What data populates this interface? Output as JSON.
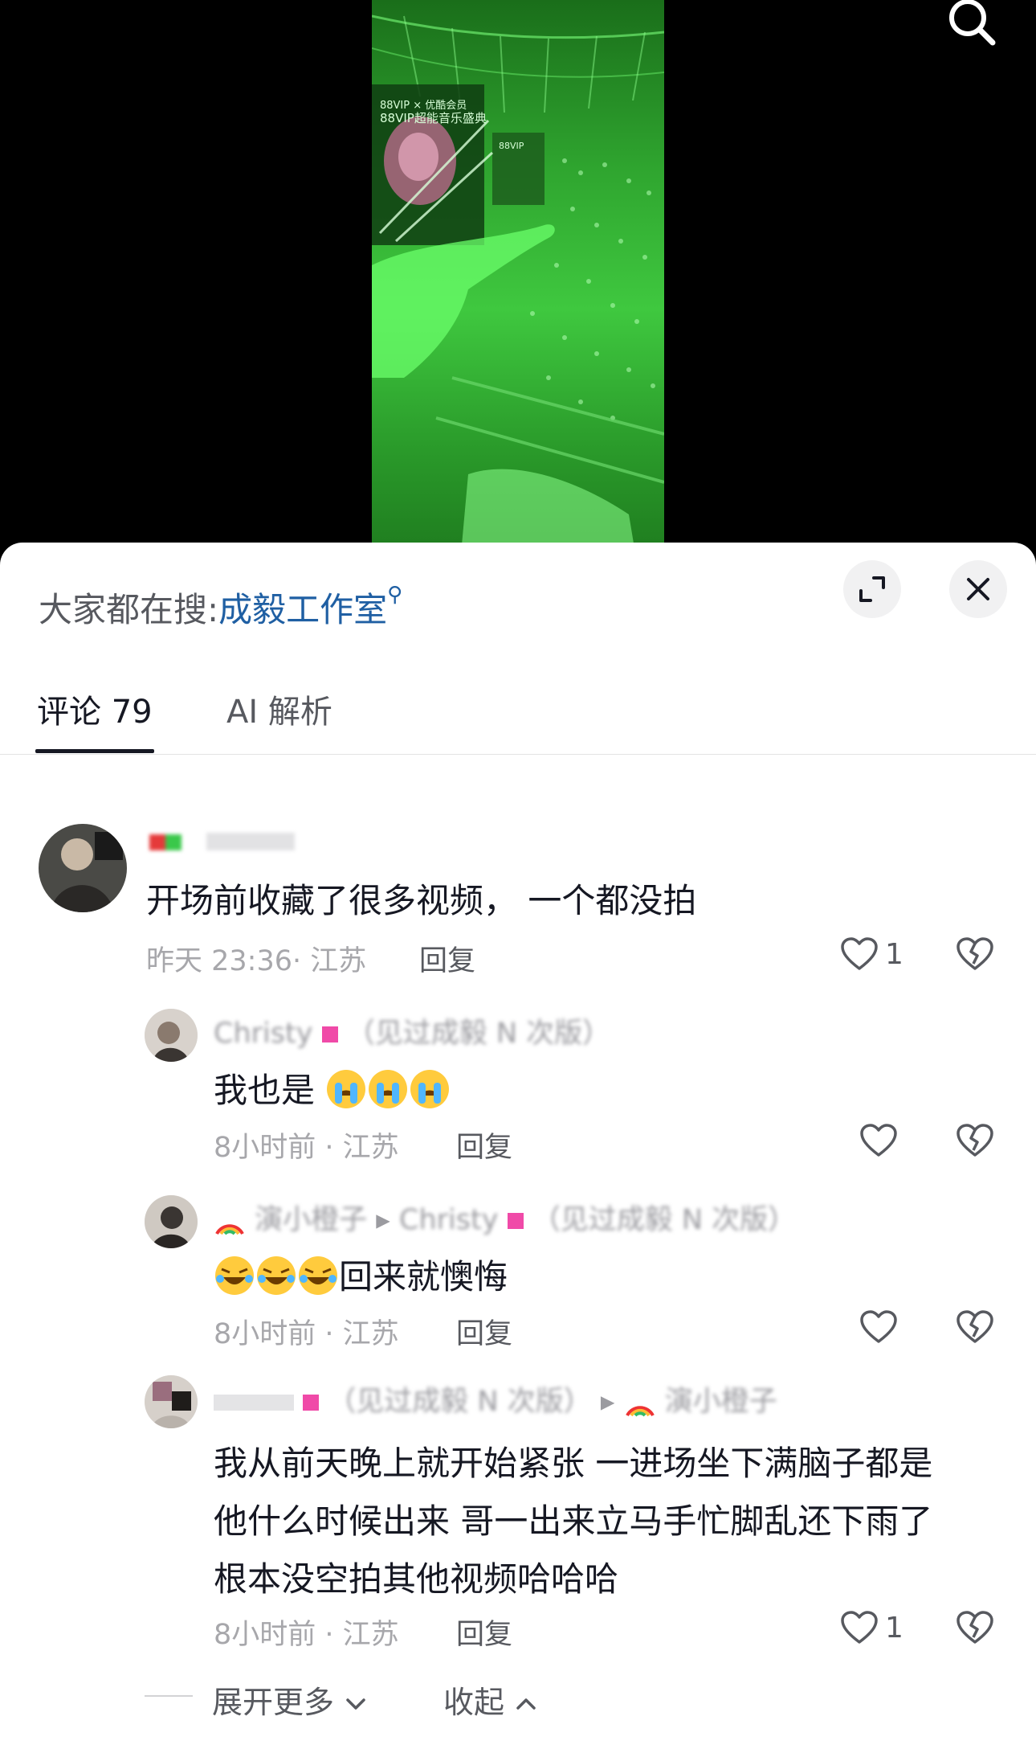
{
  "video": {
    "screen_text_line1": "88VIP × 优酷会员",
    "screen_text_line2": "88VIP超能音乐盛典",
    "screen_text_small": "88VIP"
  },
  "icons": {
    "search": "search-icon",
    "expand": "expand-icon",
    "close": "close-icon",
    "like": "heart-icon",
    "dislike": "broken-heart-icon",
    "chevron_down": "chevron-down-icon",
    "chevron_up": "chevron-up-icon"
  },
  "trending": {
    "prefix": "大家都在搜:",
    "keyword": "成毅工作室"
  },
  "tabs": {
    "comments": "评论 79",
    "ai": "AI 解析"
  },
  "comments": [
    {
      "text": "开场前收藏了很多视频， 一个都没拍",
      "time": "昨天 23:36",
      "location": "江苏",
      "reply": "回复",
      "likes": "1",
      "replies": [
        {
          "user": "Christy",
          "user_note": "（见过成毅 N 次版）",
          "text": "我也是",
          "time": "8小时前",
          "location": "江苏",
          "reply": "回复"
        },
        {
          "user": "演小橙子",
          "reply_to": "Christy",
          "reply_to_note": "（见过成毅 N 次版）",
          "text": "回来就懊悔",
          "time": "8小时前",
          "location": "江苏",
          "reply": "回复"
        },
        {
          "user": "（见过成毅 N 次版）",
          "reply_to": "演小橙子",
          "text_lines": [
            "我从前天晚上就开始紧张 一进场坐下满脑子都是",
            "他什么时候出来 哥一出来立马手忙脚乱还下雨了",
            "根本没空拍其他视频哈哈哈"
          ],
          "time": "8小时前",
          "location": "江苏",
          "reply": "回复",
          "likes": "1"
        }
      ]
    }
  ],
  "footer": {
    "expand_more": "展开更多",
    "collapse": "收起"
  },
  "colors": {
    "link": "#1f5fa3",
    "video_green": "#3fc83f"
  }
}
